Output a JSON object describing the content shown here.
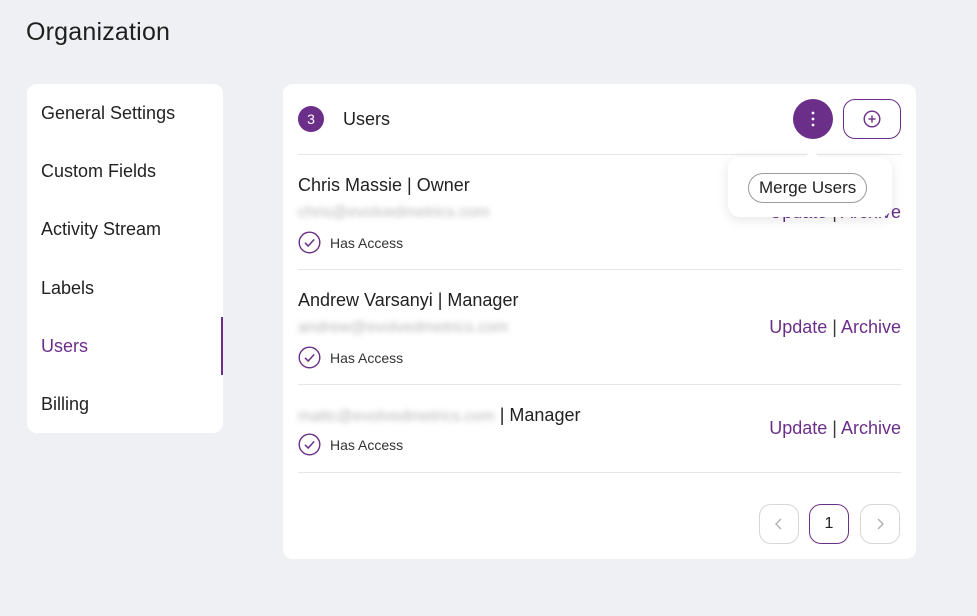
{
  "page": {
    "title": "Organization"
  },
  "sidebar": {
    "items": [
      {
        "label": "General Settings"
      },
      {
        "label": "Custom Fields"
      },
      {
        "label": "Activity Stream"
      },
      {
        "label": "Labels"
      },
      {
        "label": "Users",
        "active": true
      },
      {
        "label": "Billing"
      }
    ]
  },
  "users_panel": {
    "count": "3",
    "title": "Users",
    "more_icon": "more-vertical-icon",
    "add_icon": "plus-circle-icon",
    "rows": [
      {
        "name": "Chris Massie | Owner",
        "email": "chris@evolvedmetrics.com",
        "access": "Has Access",
        "update": "Update",
        "separator": "|",
        "archive": "Archive"
      },
      {
        "name": "Andrew Varsanyi | Manager",
        "email": "andrew@evolvedmetrics.com",
        "access": "Has Access",
        "update": "Update",
        "separator": "|",
        "archive": "Archive"
      },
      {
        "email": "mattc@evolvedmetrics.com",
        "role_suffix": " | Manager",
        "access": "Has Access",
        "update": "Update",
        "separator": "|",
        "archive": "Archive"
      }
    ]
  },
  "popover": {
    "merge_label": "Merge Users"
  },
  "pagination": {
    "current_page": "1"
  },
  "colors": {
    "accent": "#6b2f8a",
    "background": "#eff0f3",
    "card": "#ffffff"
  }
}
